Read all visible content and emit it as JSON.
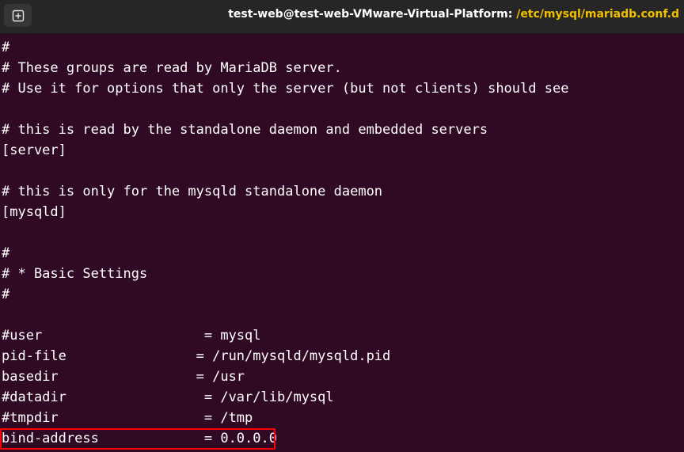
{
  "window": {
    "title_prefix": "test-web@test-web-VMware-Virtual-Platform: ",
    "title_path": "/etc/mysql/mariadb.conf.d",
    "new_tab_icon": "new-tab-icon"
  },
  "terminal": {
    "background": "#300a24",
    "text_color": "#ffffff",
    "highlight_color": "#ff0000",
    "lines": [
      "#",
      "# These groups are read by MariaDB server.",
      "# Use it for options that only the server (but not clients) should see",
      "",
      "# this is read by the standalone daemon and embedded servers",
      "[server]",
      "",
      "# this is only for the mysqld standalone daemon",
      "[mysqld]",
      "",
      "#",
      "# * Basic Settings",
      "#",
      "",
      "#user                    = mysql",
      "pid-file                = /run/mysqld/mysqld.pid",
      "basedir                 = /usr",
      "#datadir                 = /var/lib/mysql",
      "#tmpdir                  = /tmp",
      "bind-address             = 0.0.0.0"
    ],
    "highlighted_line_index": 19
  }
}
